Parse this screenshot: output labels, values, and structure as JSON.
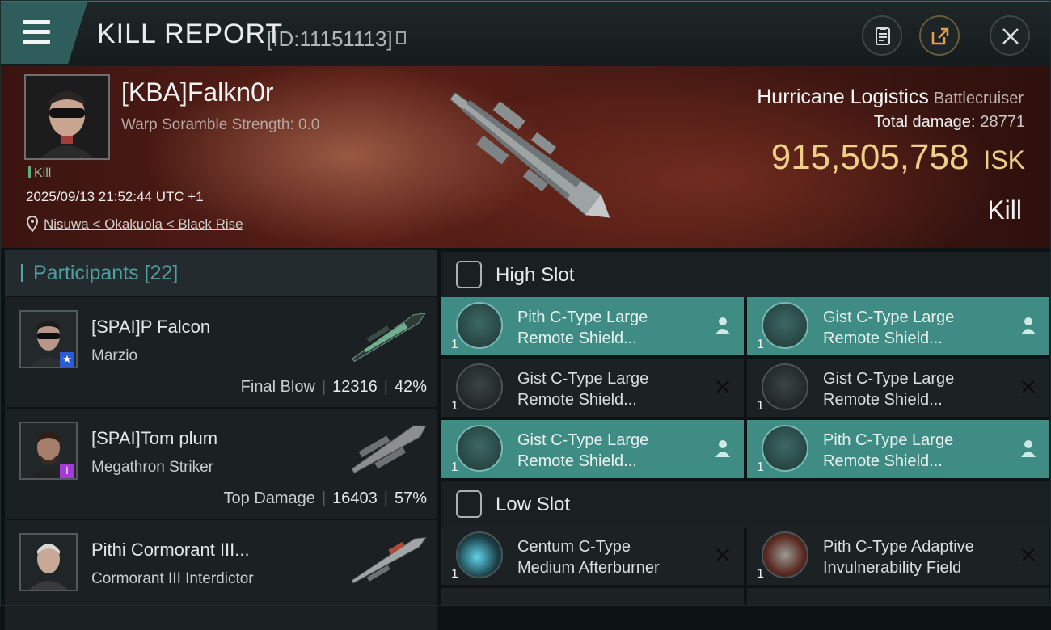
{
  "header": {
    "title": "KILL REPORT",
    "report_id": "[ID:11151113]",
    "menu_icon": "hamburger-menu-icon",
    "buttons": [
      "clipboard-icon",
      "share-icon",
      "close-icon"
    ]
  },
  "victim": {
    "name": "[KBA]Falkn0r",
    "warp_scramble": "Warp Soramble Strength: 0.0",
    "kill_tag": "Kill",
    "timestamp": "2025/09/13 21:52:44 UTC +1",
    "location": "Nisuwa < Okakuola < Black Rise",
    "ship_name": "Hurricane Logistics",
    "ship_class": "Battlecruiser",
    "total_damage_label": "Total damage:",
    "total_damage": "28771",
    "isk_value": "915,505,758",
    "isk_unit": "ISK",
    "result": "Kill"
  },
  "participants": {
    "title": "Participants [22]",
    "rows": [
      {
        "name": "[SPAI]P Falcon",
        "ship": "Marzio",
        "tag": "Final Blow",
        "damage": "12316",
        "percent": "42%",
        "badge": "★",
        "badge_color": "#2a5bd7"
      },
      {
        "name": "[SPAI]Tom plum",
        "ship": "Megathron Striker",
        "tag": "Top Damage",
        "damage": "16403",
        "percent": "57%",
        "badge": "i",
        "badge_color": "#a33bd6"
      },
      {
        "name": "Pithi Cormorant III...",
        "ship": "Cormorant III Interdictor"
      }
    ]
  },
  "fitting": {
    "high_slot_title": "High Slot",
    "low_slot_title": "Low Slot",
    "high_slot": [
      {
        "line1": "Pith C-Type Large",
        "line2": "Remote Shield...",
        "qty": "1",
        "status": "person-icon"
      },
      {
        "line1": "Gist C-Type Large",
        "line2": "Remote Shield...",
        "qty": "1",
        "status": "person-icon"
      },
      {
        "line1": "Gist C-Type Large",
        "line2": "Remote Shield...",
        "qty": "1",
        "status": "destroyed-x-icon"
      },
      {
        "line1": "Gist C-Type Large",
        "line2": "Remote Shield...",
        "qty": "1",
        "status": "destroyed-x-icon"
      },
      {
        "line1": "Gist C-Type Large",
        "line2": "Remote Shield...",
        "qty": "1",
        "status": "person-icon"
      },
      {
        "line1": "Pith C-Type Large",
        "line2": "Remote Shield...",
        "qty": "1",
        "status": "person-icon"
      }
    ],
    "low_slot": [
      {
        "line1": "Centum C-Type",
        "line2": "Medium Afterburner",
        "qty": "1",
        "status": "destroyed-x-icon"
      },
      {
        "line1": "Pith C-Type Adaptive",
        "line2": "Invulnerability Field",
        "qty": "1",
        "status": "destroyed-x-icon"
      }
    ]
  },
  "colors": {
    "accent": "#3f8c84",
    "isk": "#efcf87",
    "kill_tag": "#5fae7f"
  }
}
